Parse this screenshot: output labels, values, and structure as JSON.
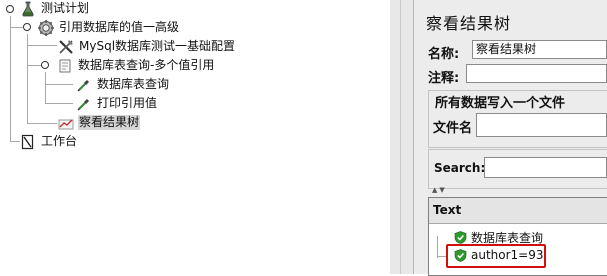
{
  "tree": {
    "items": [
      {
        "label": "测试计划"
      },
      {
        "label": "引用数据库的值一高级"
      },
      {
        "label": "MySql数据库测试一基础配置"
      },
      {
        "label": "数据库表查询-多个值引用"
      },
      {
        "label": "数据库表查询"
      },
      {
        "label": "打印引用值"
      },
      {
        "label": "察看结果树"
      },
      {
        "label": "工作台"
      }
    ]
  },
  "panel": {
    "title": "察看结果树",
    "name_label": "名称:",
    "name_value": "察看结果树",
    "comment_label": "注释:",
    "comment_value": "",
    "write_all_label": "所有数据写入一个文件",
    "filename_label": "文件名",
    "filename_value": "",
    "search_label": "Search:",
    "search_value": "",
    "text_header": "Text",
    "results": [
      {
        "label": "数据库表查询"
      },
      {
        "label": "author1=93"
      }
    ]
  },
  "colors": {
    "selection": "#d6d6d6",
    "success": "#2e9a2e",
    "highlight_box": "#d01010"
  }
}
